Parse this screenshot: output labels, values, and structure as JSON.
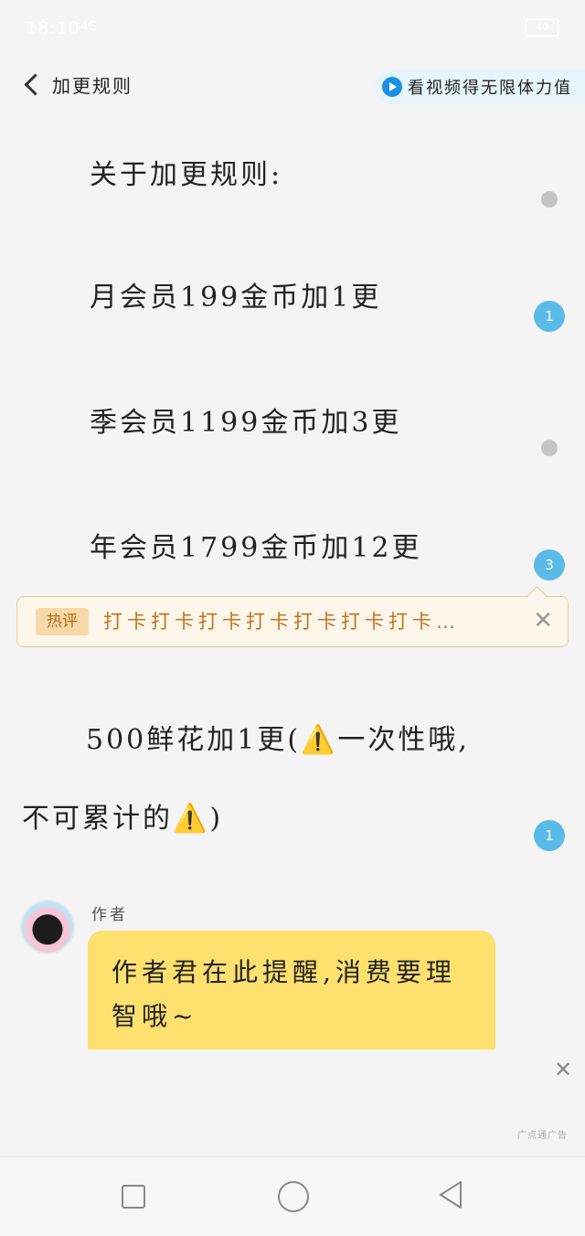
{
  "status_bar": {
    "time": "18:10",
    "signal": "4G",
    "battery": "40"
  },
  "header": {
    "back_label": "加更规则",
    "video_prompt": "看视频得无限体力值"
  },
  "content": {
    "heading": "关于加更规则:",
    "lines": [
      "月会员199金币加1更",
      "季会员1199金币加3更",
      "年会员1799金币加12更",
      "500鲜花加1更(⚠️一次性哦,",
      "不可累计的⚠️)"
    ]
  },
  "comment_markers": [
    "1",
    "3",
    "1"
  ],
  "hot_comment": {
    "tag": "热评",
    "text": "打卡打卡打卡打卡打卡打卡打卡…",
    "close": "✕"
  },
  "author_note": {
    "label": "作者",
    "message": "作者君在此提醒,消费要理智哦~"
  },
  "ad": {
    "close": "✕",
    "label": "广点通广告"
  },
  "icons": {
    "back": "chevron-left-icon",
    "play": "play-circle-icon",
    "nav_square": "recent-apps-icon",
    "nav_circle": "home-icon",
    "nav_triangle": "back-triangle-icon"
  },
  "colors": {
    "accent_blue": "#5bbbe8",
    "bubble_yellow": "#fde06e",
    "hot_orange": "#c4731c"
  }
}
